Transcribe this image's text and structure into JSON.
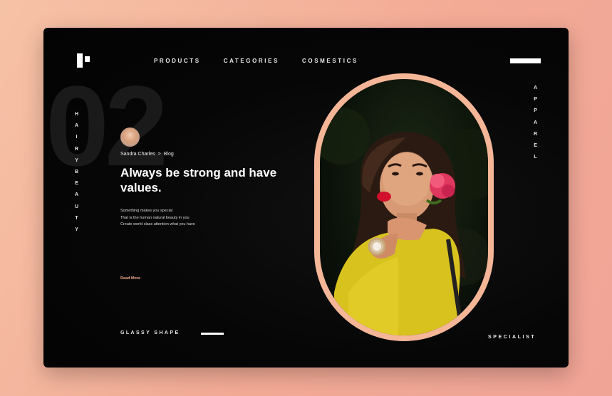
{
  "nav": {
    "items": [
      "PRODUCTS",
      "CATEGORIES",
      "COSMESTICS"
    ]
  },
  "left_vertical": "HAIRYBEAUTY",
  "right_vertical": "APPAREL",
  "big_number": "02",
  "post": {
    "author": "Sandra Charles",
    "separator": ">",
    "category": "Blog",
    "headline": "Always be strong and have values.",
    "description": [
      "Something makes you special",
      "That is the human natural beauty in you",
      "Create world class attention what you have"
    ],
    "read_more": "Read More"
  },
  "footer": {
    "left": "GLASSY SHAPE",
    "right": "SPECIALIST"
  },
  "colors": {
    "accent": "#f4b697",
    "background": "#050505",
    "outer": "#f3ab96"
  },
  "icons": [
    "logo-icon",
    "menu-icon"
  ]
}
